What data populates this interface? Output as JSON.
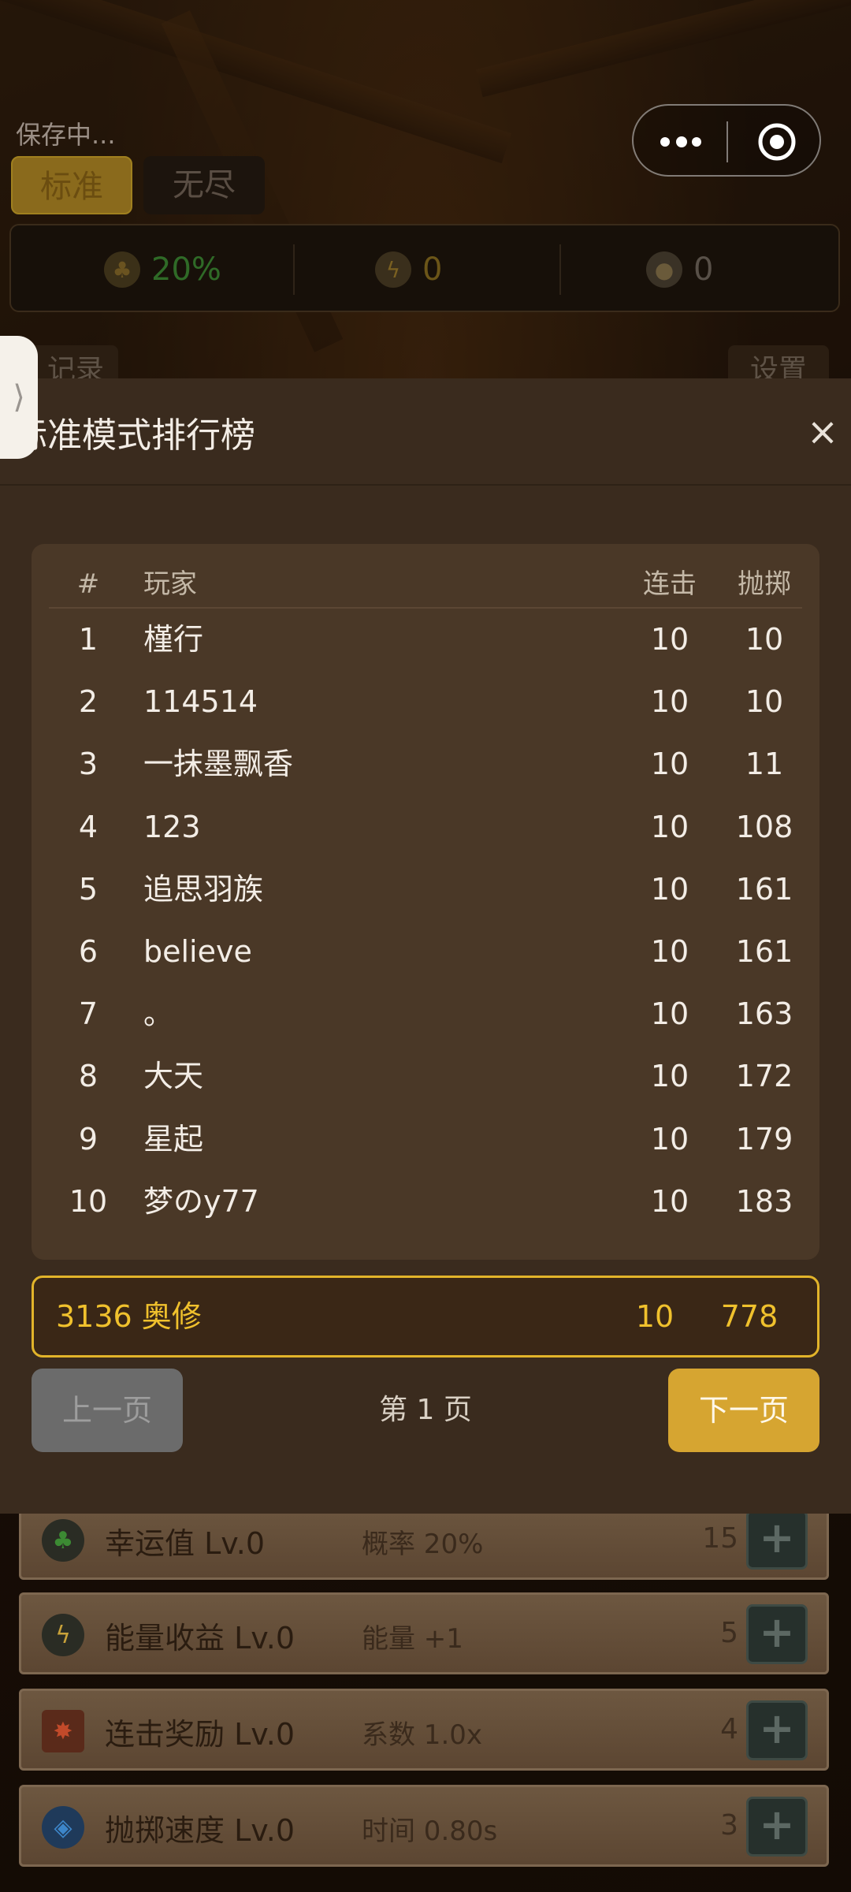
{
  "status": {
    "save_text": "保存中..."
  },
  "modes": {
    "standard": "标准",
    "endless": "无尽"
  },
  "stats": {
    "luck": "20%",
    "energy": "0",
    "coins": "0"
  },
  "peek_buttons": {
    "left": "记录",
    "right": "设置"
  },
  "side_handle": "⟩",
  "leaderboard": {
    "title": "标准模式排行榜",
    "close": "×",
    "columns": {
      "rank": "#",
      "player": "玩家",
      "combo": "连击",
      "throws": "抛掷"
    },
    "rows": [
      {
        "rank": "1",
        "name": "槿行",
        "combo": "10",
        "throws": "10"
      },
      {
        "rank": "2",
        "name": "114514",
        "combo": "10",
        "throws": "10"
      },
      {
        "rank": "3",
        "name": "一抹墨飘香",
        "combo": "10",
        "throws": "11"
      },
      {
        "rank": "4",
        "name": "123",
        "combo": "10",
        "throws": "108"
      },
      {
        "rank": "5",
        "name": "追思羽族",
        "combo": "10",
        "throws": "161"
      },
      {
        "rank": "6",
        "name": "believe",
        "combo": "10",
        "throws": "161"
      },
      {
        "rank": "7",
        "name": "。",
        "combo": "10",
        "throws": "163"
      },
      {
        "rank": "8",
        "name": "大天",
        "combo": "10",
        "throws": "172"
      },
      {
        "rank": "9",
        "name": "星起",
        "combo": "10",
        "throws": "179"
      },
      {
        "rank": "10",
        "name": "梦のy77",
        "combo": "10",
        "throws": "183"
      }
    ],
    "me": {
      "rank_name": "3136 奥修",
      "combo": "10",
      "throws": "778"
    },
    "pager": {
      "prev": "上一页",
      "page": "第 1 页",
      "next": "下一页"
    }
  },
  "upgrades": [
    {
      "name": "幸运值 Lv.0",
      "desc": "概率 20%",
      "cost": "15",
      "plus": "+"
    },
    {
      "name": "能量收益 Lv.0",
      "desc": "能量 +1",
      "cost": "5",
      "plus": "+"
    },
    {
      "name": "连击奖励 Lv.0",
      "desc": "系数 1.0x",
      "cost": "4",
      "plus": "+"
    },
    {
      "name": "抛掷速度 Lv.0",
      "desc": "时间 0.80s",
      "cost": "3",
      "plus": "+"
    }
  ],
  "colors": {
    "accent": "#d6a531",
    "highlight": "#f0c12d",
    "panel": "#3a2b1e",
    "table": "#4a3827"
  }
}
